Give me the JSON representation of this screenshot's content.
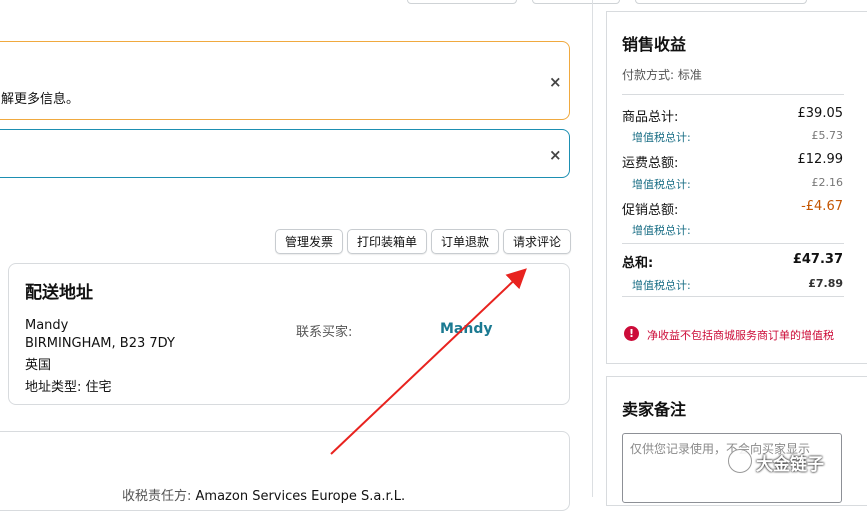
{
  "alerts": {
    "orange_text": "解更多信息。",
    "close_glyph": "×"
  },
  "actions": {
    "manage_invoice": "管理发票",
    "print_packing_slip": "打印装箱单",
    "refund_order": "订单退款",
    "request_review": "请求评论"
  },
  "shipping": {
    "title": "配送地址",
    "name": "Mandy",
    "city_line": "BIRMINGHAM, B23 7DY",
    "country": "英国",
    "address_type_label": "地址类型:",
    "address_type_value": "住宅",
    "contact_label": "联系买家:",
    "contact_name": "Mandy"
  },
  "tax": {
    "label": "收税责任方:",
    "value": "Amazon Services Europe S.a.r.L."
  },
  "summary": {
    "title": "销售收益",
    "payment_method": "付款方式: 标准",
    "rows": [
      {
        "label": "商品总计:",
        "value": "£39.05",
        "vat_label": "增值税总计:",
        "vat_value": "£5.73"
      },
      {
        "label": "运费总额:",
        "value": "£12.99",
        "vat_label": "增值税总计:",
        "vat_value": "£2.16"
      },
      {
        "label": "促销总额:",
        "value": "-£4.67",
        "vat_label": "增值税总计:",
        "vat_value": ""
      }
    ],
    "total_label": "总和:",
    "total_value": "£47.37",
    "total_vat_label": "增值税总计:",
    "total_vat_value": "£7.89",
    "warning": "净收益不包括商城服务商订单的增值税",
    "promo_color": "#c45500"
  },
  "notes": {
    "title": "卖家备注",
    "placeholder": "仅供您记录使用，不会向买家显示"
  },
  "watermark": {
    "text": "大金链子"
  }
}
